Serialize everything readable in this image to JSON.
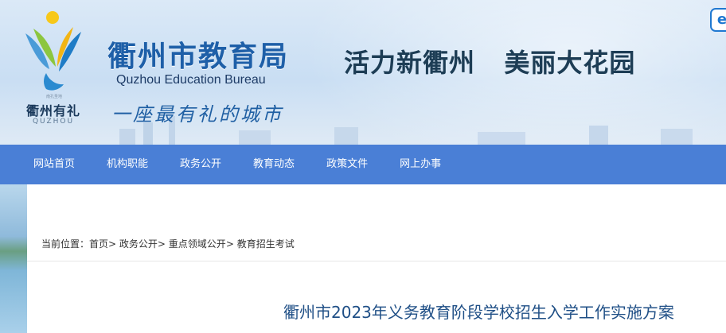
{
  "header": {
    "logo_brand": "衢州有礼",
    "logo_brand_en": "QUZHOU",
    "logo_mini": "南孔圣地",
    "site_name_cn": "衢州市教育局",
    "site_name_en": "Quzhou Education Bureau",
    "slogan_small": "一座最有礼的城市",
    "slogan_big": "活力新衢州   美丽大花园",
    "browser_icon": "e"
  },
  "nav": {
    "items": [
      {
        "label": "网站首页"
      },
      {
        "label": "机构职能"
      },
      {
        "label": "政务公开"
      },
      {
        "label": "教育动态"
      },
      {
        "label": "政策文件"
      },
      {
        "label": "网上办事"
      }
    ]
  },
  "breadcrumb": {
    "prefix": "当前位置：",
    "items": [
      "首页",
      "政务公开",
      "重点领域公开",
      "教育招生考试"
    ],
    "separator": "> "
  },
  "article": {
    "title": "衢州市2023年义务教育阶段学校招生入学工作实施方案"
  },
  "colors": {
    "nav_bg": "#4a7fd6",
    "site_name": "#1e5fa8",
    "title": "#1f4f86"
  }
}
